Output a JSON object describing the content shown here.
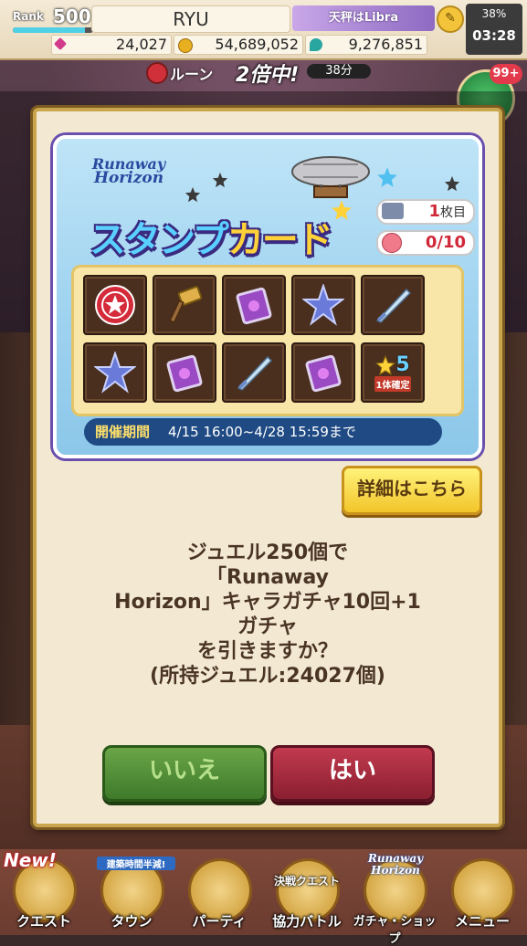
{
  "status_bar": {
    "rank_label": "Rank",
    "rank_value": "500",
    "rank_progress": 0.9,
    "player_name": "RYU",
    "event_banner": "天秤はLibra",
    "battery": "38%",
    "clock": "03:28",
    "gems": "24,027",
    "coins": "54,689,052",
    "third_currency": "9,276,851"
  },
  "rune_boost": {
    "label": "ルーン",
    "multiplier": "2倍中!",
    "time_left": "38分"
  },
  "gift": {
    "badge": "99+"
  },
  "dialog": {
    "logo_line1": "Runaway",
    "logo_line2": "Horizon",
    "stamp_title_1": "スタンプ",
    "stamp_title_2": "カード",
    "card_number": "1",
    "card_number_unit": "枚目",
    "stamp_progress": "0/10",
    "bonus_star": "5",
    "bonus_label": "1体確定",
    "period_label": "開催期間",
    "period_value": "4/15  16:00~4/28  15:59まで",
    "detail_button": "詳細はこちら",
    "message_lines": [
      "ジュエル250個で",
      "「Runaway",
      "Horizon」キャラガチャ10回+1",
      "ガチャ",
      "を引きますか？",
      "(所持ジュエル:24027個)"
    ],
    "no_button": "いいえ",
    "yes_button": "はい"
  },
  "nav": {
    "items": [
      {
        "label": "クエスト",
        "icon": "quest-icon"
      },
      {
        "label": "タウン",
        "icon": "town-icon"
      },
      {
        "label": "パーティ",
        "icon": "party-icon"
      },
      {
        "label": "協力バトル",
        "icon": "coop-battle-icon"
      },
      {
        "label": "ガチャ・ショップ",
        "icon": "gacha-shop-icon"
      },
      {
        "label": "メニュー",
        "icon": "menu-icon"
      }
    ],
    "new_tag": "New!",
    "town_badge": "建築時間半減!",
    "coop_event": "決戦クエスト",
    "gacha_event_line1": "Runaway",
    "gacha_event_line2": "Horizon"
  },
  "colors": {
    "dialog_bg": "#f3e9d3",
    "dialog_border": "#c9a64d",
    "no_button": "#3e7a2a",
    "yes_button": "#8a1f30",
    "detail_button": "#f2c52a",
    "period_bar": "#1f4a84"
  }
}
